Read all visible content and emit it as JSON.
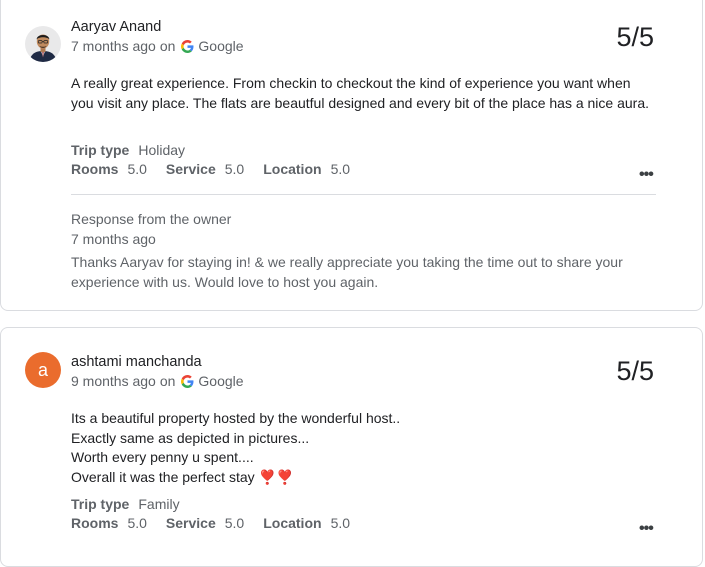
{
  "reviews": [
    {
      "author": "Aaryav Anand",
      "time": "7 months ago",
      "on": "on",
      "source": "Google",
      "rating": "5/5",
      "text": "A really great experience. From checkin to checkout the kind of experience you want when you visit any place. The flats are beautful designed and every bit of the place has a nice aura.",
      "trip_type_label": "Trip type",
      "trip_type": "Holiday",
      "rooms_label": "Rooms",
      "rooms": "5.0",
      "service_label": "Service",
      "service": "5.0",
      "location_label": "Location",
      "location": "5.0",
      "more": "•••",
      "response_title": "Response from the owner",
      "response_time": "7 months ago",
      "response_text": "Thanks Aaryav for staying in! & we really appreciate you taking the time out to share your experience with us. Would love to host you again."
    },
    {
      "author": "ashtami manchanda",
      "avatar_letter": "a",
      "time": "9 months ago",
      "on": "on",
      "source": "Google",
      "rating": "5/5",
      "text": "Its a beautiful property hosted by the wonderful host..\nExactly same as depicted in pictures...\nWorth every penny u spent....\nOverall it was the perfect stay ❣️❣️",
      "trip_type_label": "Trip type",
      "trip_type": "Family",
      "rooms_label": "Rooms",
      "rooms": "5.0",
      "service_label": "Service",
      "service": "5.0",
      "location_label": "Location",
      "location": "5.0",
      "more": "•••"
    }
  ],
  "colors": {
    "avatar_bg": "#ea6c2d",
    "text_primary": "#202124",
    "text_secondary": "#5f6368",
    "border": "#dadce0"
  }
}
